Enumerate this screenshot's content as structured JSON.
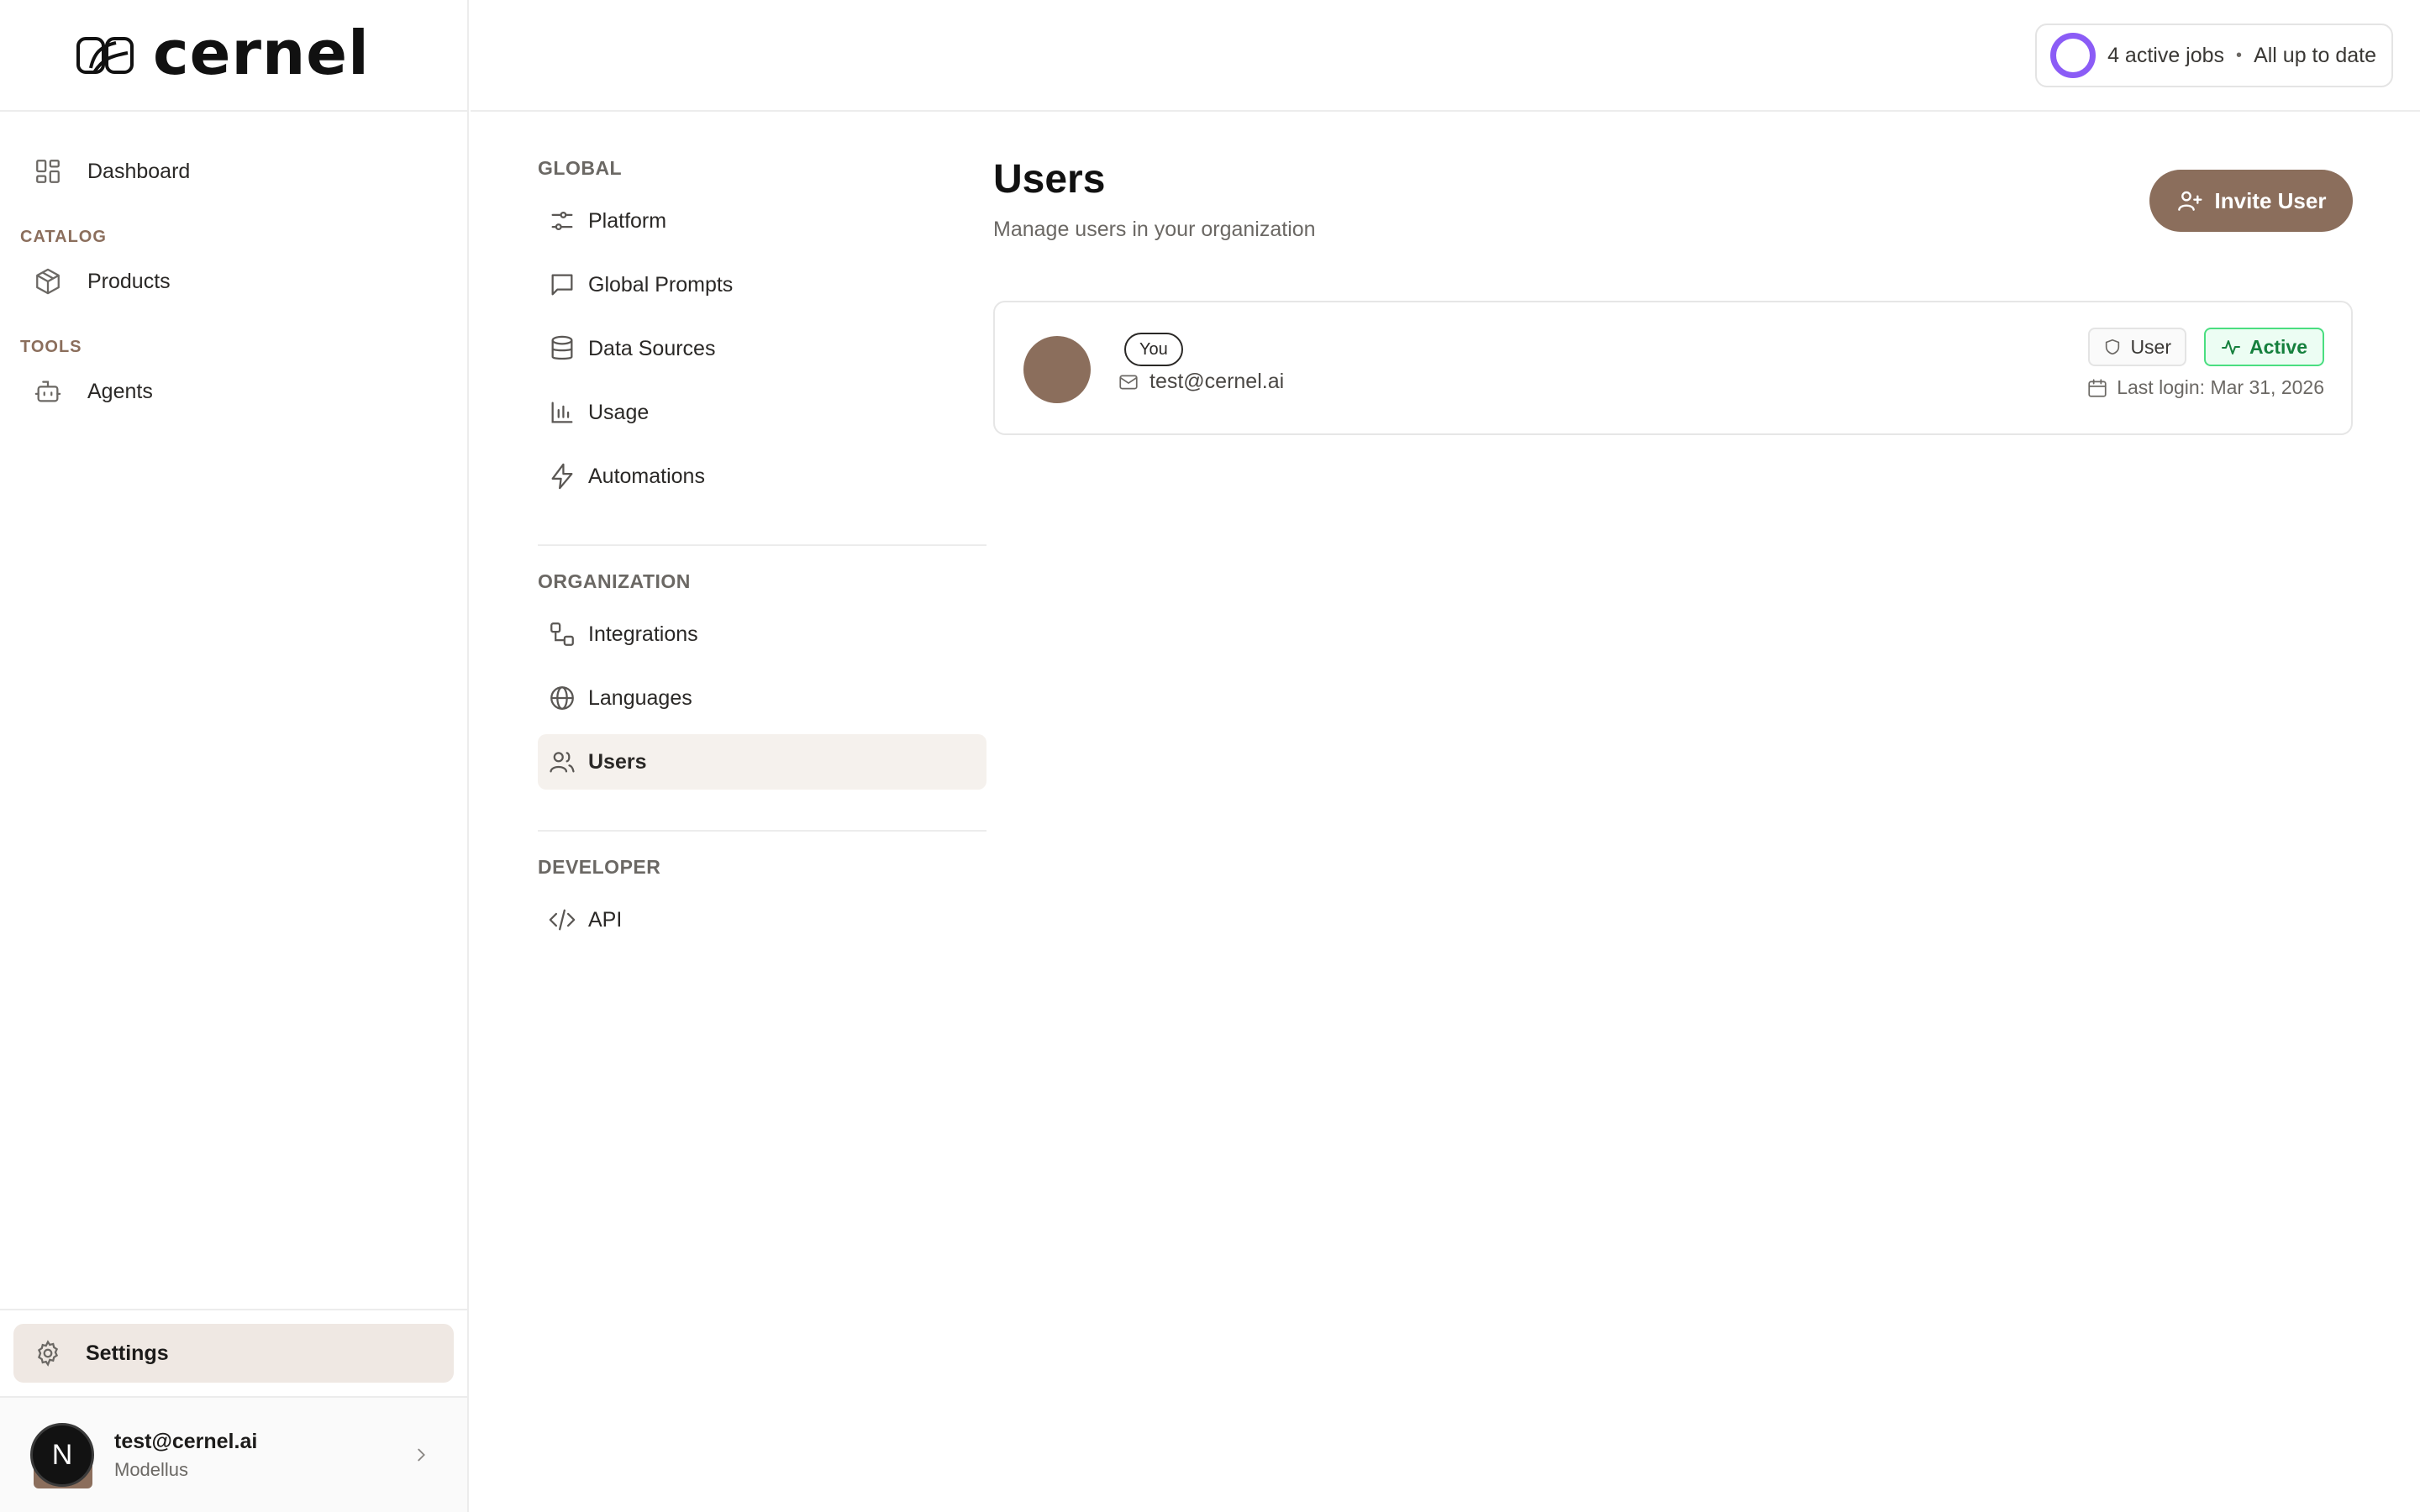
{
  "brand": {
    "name": "cernel"
  },
  "sidebar": {
    "items": [
      {
        "label": "Dashboard",
        "icon": "dashboard-icon"
      }
    ],
    "sections": [
      {
        "title": "CATALOG",
        "items": [
          {
            "label": "Products",
            "icon": "box-icon"
          }
        ]
      },
      {
        "title": "TOOLS",
        "items": [
          {
            "label": "Agents",
            "icon": "bot-icon"
          }
        ]
      }
    ],
    "settings_label": "Settings",
    "account": {
      "email": "test@cernel.ai",
      "org": "Modellus",
      "avatar_initial": "N"
    }
  },
  "topbar": {
    "jobs": "4 active jobs",
    "separator": "•",
    "status": "All up to date",
    "accent_color": "#8b5cf6"
  },
  "settings_nav": {
    "global": {
      "title": "GLOBAL",
      "items": [
        "Platform",
        "Global Prompts",
        "Data Sources",
        "Usage",
        "Automations"
      ]
    },
    "organization": {
      "title": "ORGANIZATION",
      "items": [
        "Integrations",
        "Languages",
        "Users"
      ]
    },
    "developer": {
      "title": "DEVELOPER",
      "items": [
        "API"
      ]
    },
    "active": "Users"
  },
  "main": {
    "title": "Users",
    "subtitle": "Manage users in your organization",
    "invite_label": "Invite User",
    "users": [
      {
        "badge": "You",
        "email": "test@cernel.ai",
        "role": "User",
        "status": "Active",
        "last_login": "Last login: Mar 31, 2026"
      }
    ]
  },
  "colors": {
    "brand_brown": "#8b6e5c",
    "active_green": "#15803d",
    "active_bg": "#ecfdf3",
    "selected_bg": "#f5f1ed"
  }
}
